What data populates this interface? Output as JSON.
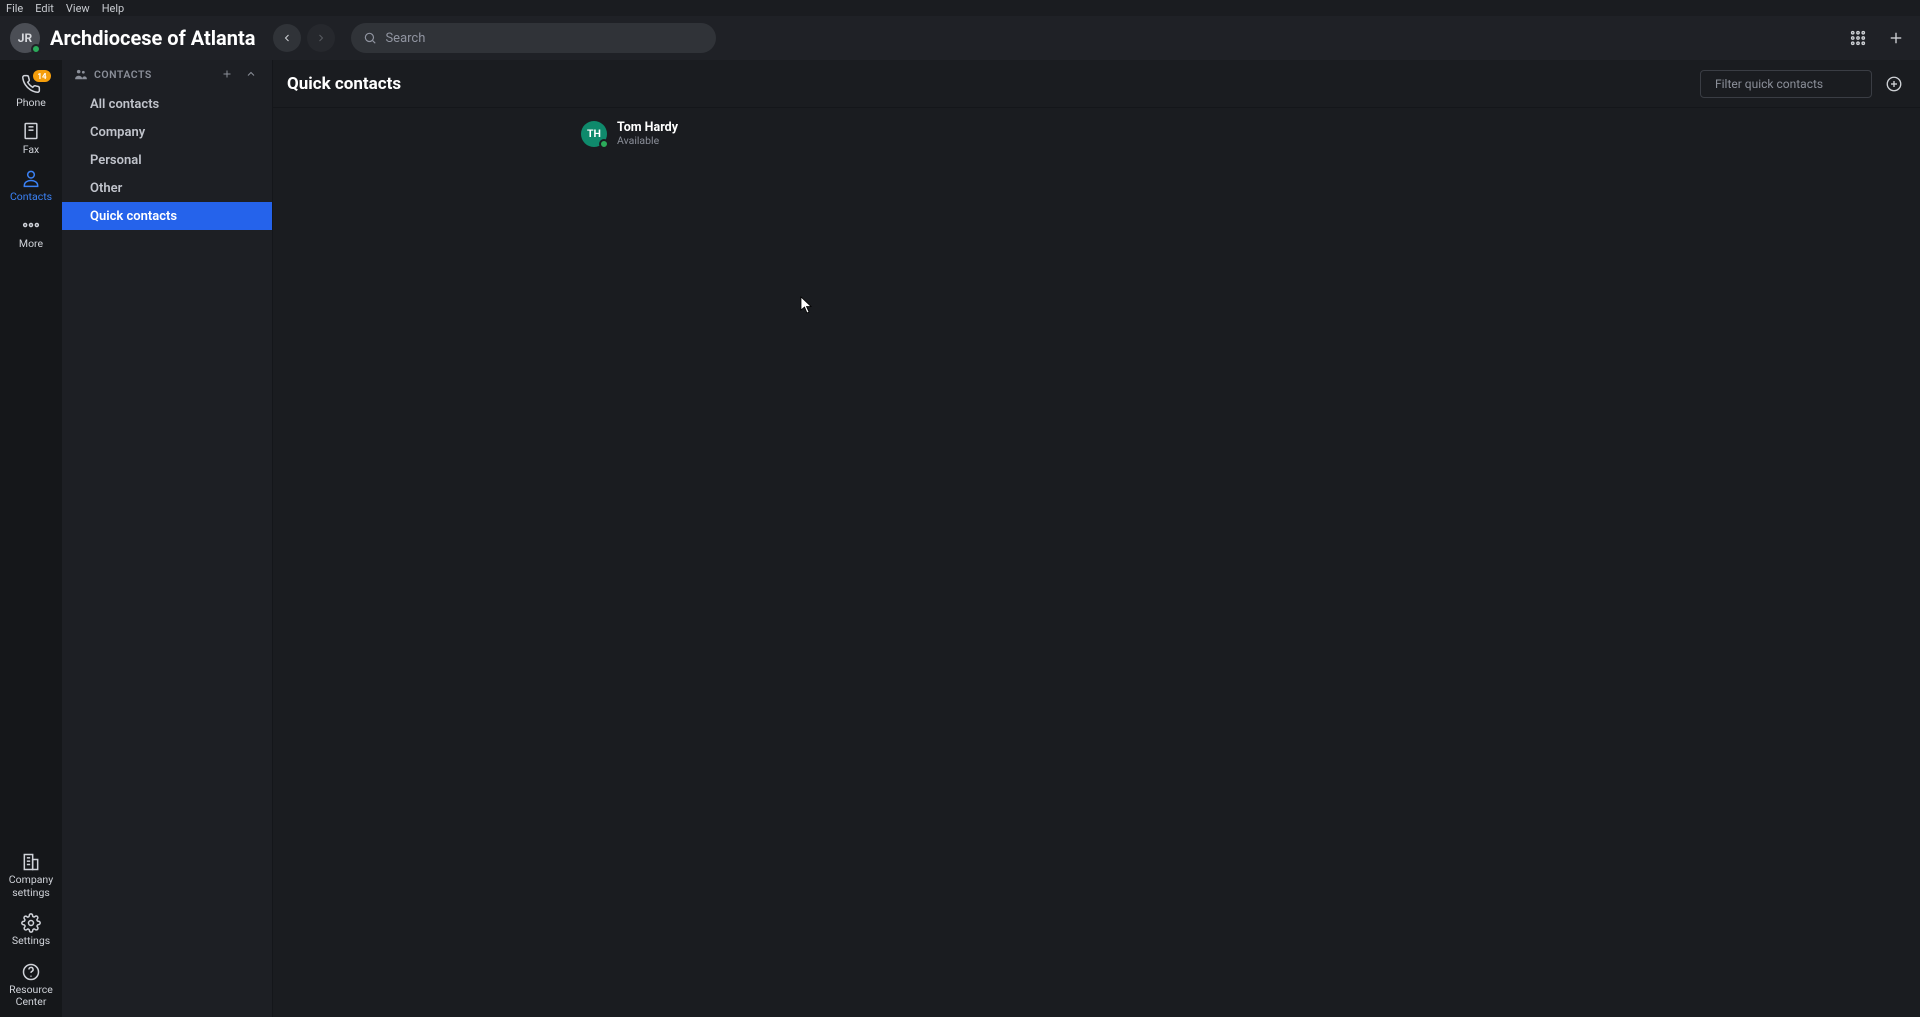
{
  "menubar": {
    "items": [
      "File",
      "Edit",
      "View",
      "Help"
    ]
  },
  "header": {
    "avatar_initials": "JR",
    "org_title": "Archdiocese of Atlanta",
    "search_placeholder": "Search"
  },
  "rail": {
    "phone": {
      "label": "Phone",
      "badge": "14"
    },
    "fax": {
      "label": "Fax"
    },
    "contacts": {
      "label": "Contacts"
    },
    "more": {
      "label": "More"
    },
    "company_settings": {
      "label": "Company\nsettings"
    },
    "settings": {
      "label": "Settings"
    },
    "resource_center": {
      "label": "Resource\nCenter"
    }
  },
  "contactsnav": {
    "title": "CONTACTS",
    "items": [
      {
        "label": "All contacts",
        "active": false
      },
      {
        "label": "Company",
        "active": false
      },
      {
        "label": "Personal",
        "active": false
      },
      {
        "label": "Other",
        "active": false
      },
      {
        "label": "Quick contacts",
        "active": true
      }
    ]
  },
  "main": {
    "title": "Quick contacts",
    "filter_placeholder": "Filter quick contacts",
    "contacts": [
      {
        "initials": "TH",
        "name": "Tom Hardy",
        "status": "Available",
        "avatar_color": "#0f8a6c"
      }
    ]
  }
}
